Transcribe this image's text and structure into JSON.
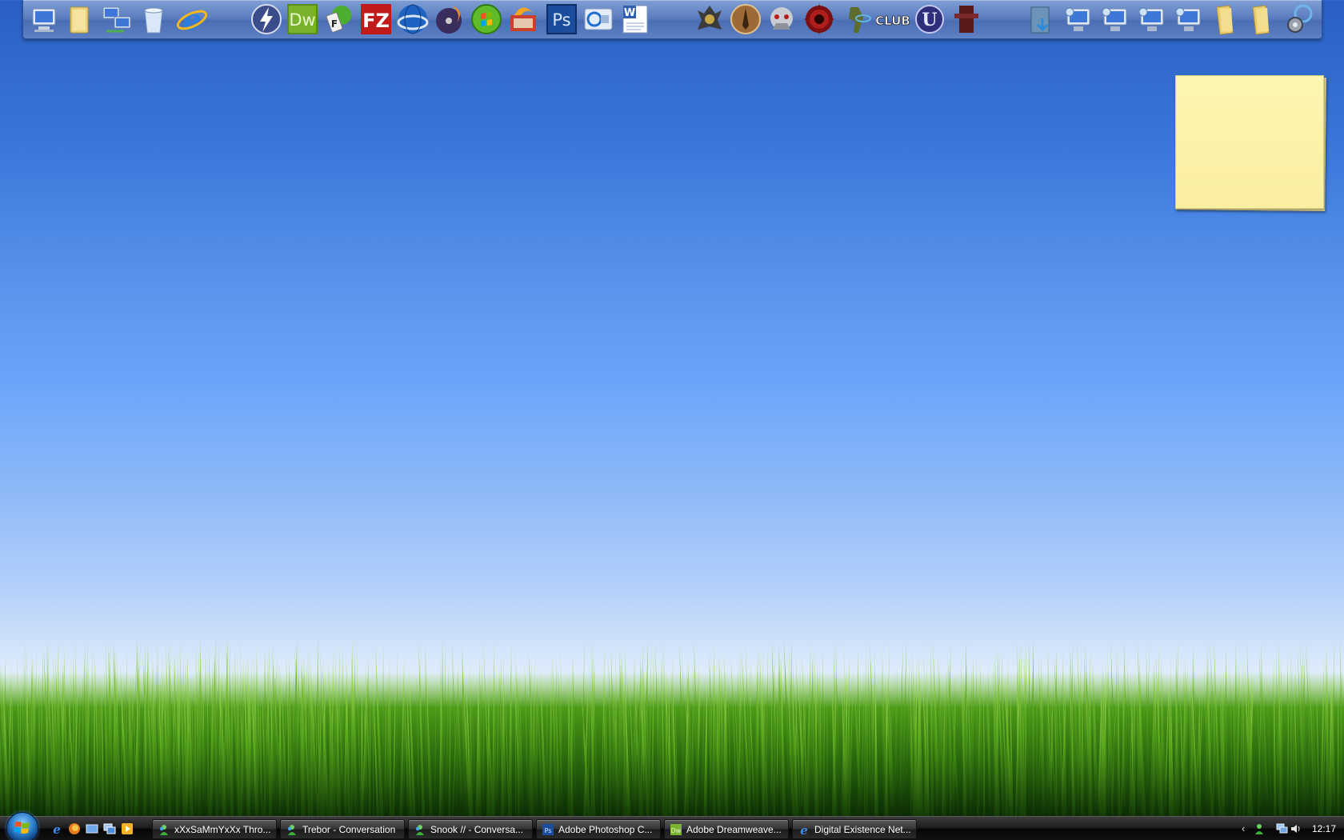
{
  "desktop": {
    "wallpaper": "grass-and-sky",
    "sky_colors": [
      "#2a5fc4",
      "#6aa4fa",
      "#e8f1fb"
    ],
    "grass_colors": [
      "#0f3a06",
      "#3f8a14",
      "#8cd23a"
    ]
  },
  "dock": {
    "icons": [
      {
        "name": "computer-icon"
      },
      {
        "name": "user-folder-icon"
      },
      {
        "name": "network-icon"
      },
      {
        "name": "recycle-bin-icon"
      },
      {
        "name": "internet-explorer-icon"
      },
      {
        "name": "download-accelerator-icon"
      },
      {
        "name": "dreamweaver-icon",
        "text": "Dw"
      },
      {
        "name": "fireworks-icon"
      },
      {
        "name": "filezilla-icon",
        "text": "FZ"
      },
      {
        "name": "google-earth-icon"
      },
      {
        "name": "disc-burner-icon"
      },
      {
        "name": "windows-media-center-icon"
      },
      {
        "name": "burning-app-icon"
      },
      {
        "name": "photoshop-icon",
        "text": "Ps"
      },
      {
        "name": "media-player-icon"
      },
      {
        "name": "word-icon",
        "text": "W"
      },
      {
        "name": "samurai-game-icon"
      },
      {
        "name": "assassins-creed-icon"
      },
      {
        "name": "mech-game-icon"
      },
      {
        "name": "gears-of-war-icon"
      },
      {
        "name": "halo-game-icon"
      },
      {
        "name": "club-game-icon",
        "text": "CLUB"
      },
      {
        "name": "unreal-tournament-icon",
        "text": "U"
      },
      {
        "name": "unreal-tournament-3-icon"
      },
      {
        "name": "downloads-folder-icon"
      },
      {
        "name": "network-drive-1-icon"
      },
      {
        "name": "network-drive-2-icon"
      },
      {
        "name": "network-drive-3-icon"
      },
      {
        "name": "network-drive-4-icon"
      },
      {
        "name": "folder-1-icon"
      },
      {
        "name": "folder-2-icon"
      },
      {
        "name": "control-panel-icon"
      }
    ]
  },
  "sticky_note": {
    "color": "#fcf3a8"
  },
  "taskbar": {
    "quick_launch": [
      {
        "name": "ie-quicklaunch-icon"
      },
      {
        "name": "firefox-quicklaunch-icon"
      },
      {
        "name": "show-desktop-icon"
      },
      {
        "name": "switch-windows-icon"
      },
      {
        "name": "media-quicklaunch-icon"
      }
    ],
    "tasks": [
      {
        "name": "task-msn-throw",
        "label": "xXxSaMmYxXx Thro...",
        "icon": "msn-icon"
      },
      {
        "name": "task-trebor",
        "label": "Trebor - Conversation",
        "icon": "msn-icon"
      },
      {
        "name": "task-snook",
        "label": "Snook // - Conversa...",
        "icon": "msn-icon"
      },
      {
        "name": "task-photoshop",
        "label": "Adobe Photoshop C...",
        "icon": "photoshop-icon"
      },
      {
        "name": "task-dreamweaver",
        "label": "Adobe Dreamweave...",
        "icon": "dreamweaver-icon"
      },
      {
        "name": "task-ie",
        "label": "Digital Existence Net...",
        "icon": "ie-icon"
      }
    ],
    "tray": {
      "chevron": "‹",
      "clock": "12:17"
    }
  }
}
